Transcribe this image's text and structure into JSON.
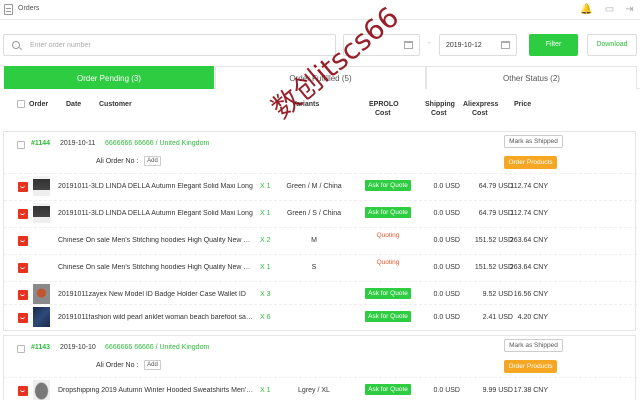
{
  "header": {
    "title": "Orders"
  },
  "search": {
    "placeholder": "Enter order number",
    "date_to": "2019-10-12",
    "date_sep": "-",
    "filter_label": "Filter",
    "download_label": "Download"
  },
  "tabs": [
    {
      "label": "Order Pending (3)",
      "active": true
    },
    {
      "label": "Order Fulfilled (5)",
      "active": false
    },
    {
      "label": "Other Status (2)",
      "active": false
    }
  ],
  "columns": {
    "order": "Order",
    "date": "Date",
    "customer": "Customer",
    "variants": "Variants",
    "eprolo_a": "EPROLO",
    "eprolo_b": "Cost",
    "shipping_a": "Shipping",
    "shipping_b": "Cost",
    "aliexpress_a": "Aliexpress",
    "aliexpress_b": "Cost",
    "price": "Price"
  },
  "orders": [
    {
      "number": "#1144",
      "date": "2019-10-11",
      "customer": "6666666 66666 / United Kingdom",
      "ali_order_label": "Ali Order No :",
      "add_label": "Add",
      "mark_label": "Mark as Shipped",
      "order_products_label": "Order Products",
      "items": [
        {
          "title": "20191011-3LD LINDA DELLA Autumn Elegant Solid Maxi Long",
          "qty": "X 1",
          "variant": "Green / M / China",
          "eprolo": "Ask for Quote",
          "shipping": "0.0 USD",
          "ali_cost": "64.79 USD",
          "price": "112.74 CNY"
        },
        {
          "title": "20191011-3LD LINDA DELLA Autumn Elegant Solid Maxi Long",
          "qty": "X 1",
          "variant": "Green / S / China",
          "eprolo": "Ask for Quote",
          "shipping": "0.0 USD",
          "ali_cost": "64.79 USD",
          "price": "112.74 CNY"
        },
        {
          "title": "Chinese On sale Men's Stitching hoodies High Quality New Bran",
          "qty": "X 2",
          "variant": "M",
          "eprolo": "Quoting",
          "shipping": "0.0 USD",
          "ali_cost": "151.52 USD",
          "price": "263.64 CNY"
        },
        {
          "title": "Chinese On sale Men's Stitching hoodies High Quality New Bran",
          "qty": "X 1",
          "variant": "S",
          "eprolo": "Quoting",
          "shipping": "0.0 USD",
          "ali_cost": "151.52 USD",
          "price": "263.64 CNY"
        },
        {
          "title": "20191011zayex New Model ID Badge Holder Case Wallet ID",
          "qty": "X 3",
          "variant": "",
          "eprolo": "Ask for Quote",
          "shipping": "0.0 USD",
          "ali_cost": "9.52 USD",
          "price": "16.56 CNY"
        },
        {
          "title": "20191011fashion wild pearl anklet woman beach barefoot sandals",
          "qty": "X 6",
          "variant": "",
          "eprolo": "Ask for Quote",
          "shipping": "0.0 USD",
          "ali_cost": "2.41 USD",
          "price": "4.20 CNY"
        }
      ]
    },
    {
      "number": "#1143",
      "date": "2019-10-10",
      "customer": "6666666 66666 / United Kingdom",
      "ali_order_label": "Ali Order No :",
      "add_label": "Add",
      "mark_label": "Mark as Shipped",
      "order_products_label": "Order Products",
      "items": [
        {
          "title": "Dropshipping 2019 Autumn Winter Hooded Sweatshirts Men's Hoo",
          "qty": "X 1",
          "variant": "Lgrey / XL",
          "eprolo": "Ask for Quote",
          "shipping": "0.0 USD",
          "ali_cost": "9.99 USD",
          "price": "17.38 CNY"
        }
      ]
    }
  ],
  "watermark": "数创itscs66",
  "colors": {
    "accent": "#2ecc40",
    "orange": "#f5a623",
    "red": "#e6321e"
  }
}
